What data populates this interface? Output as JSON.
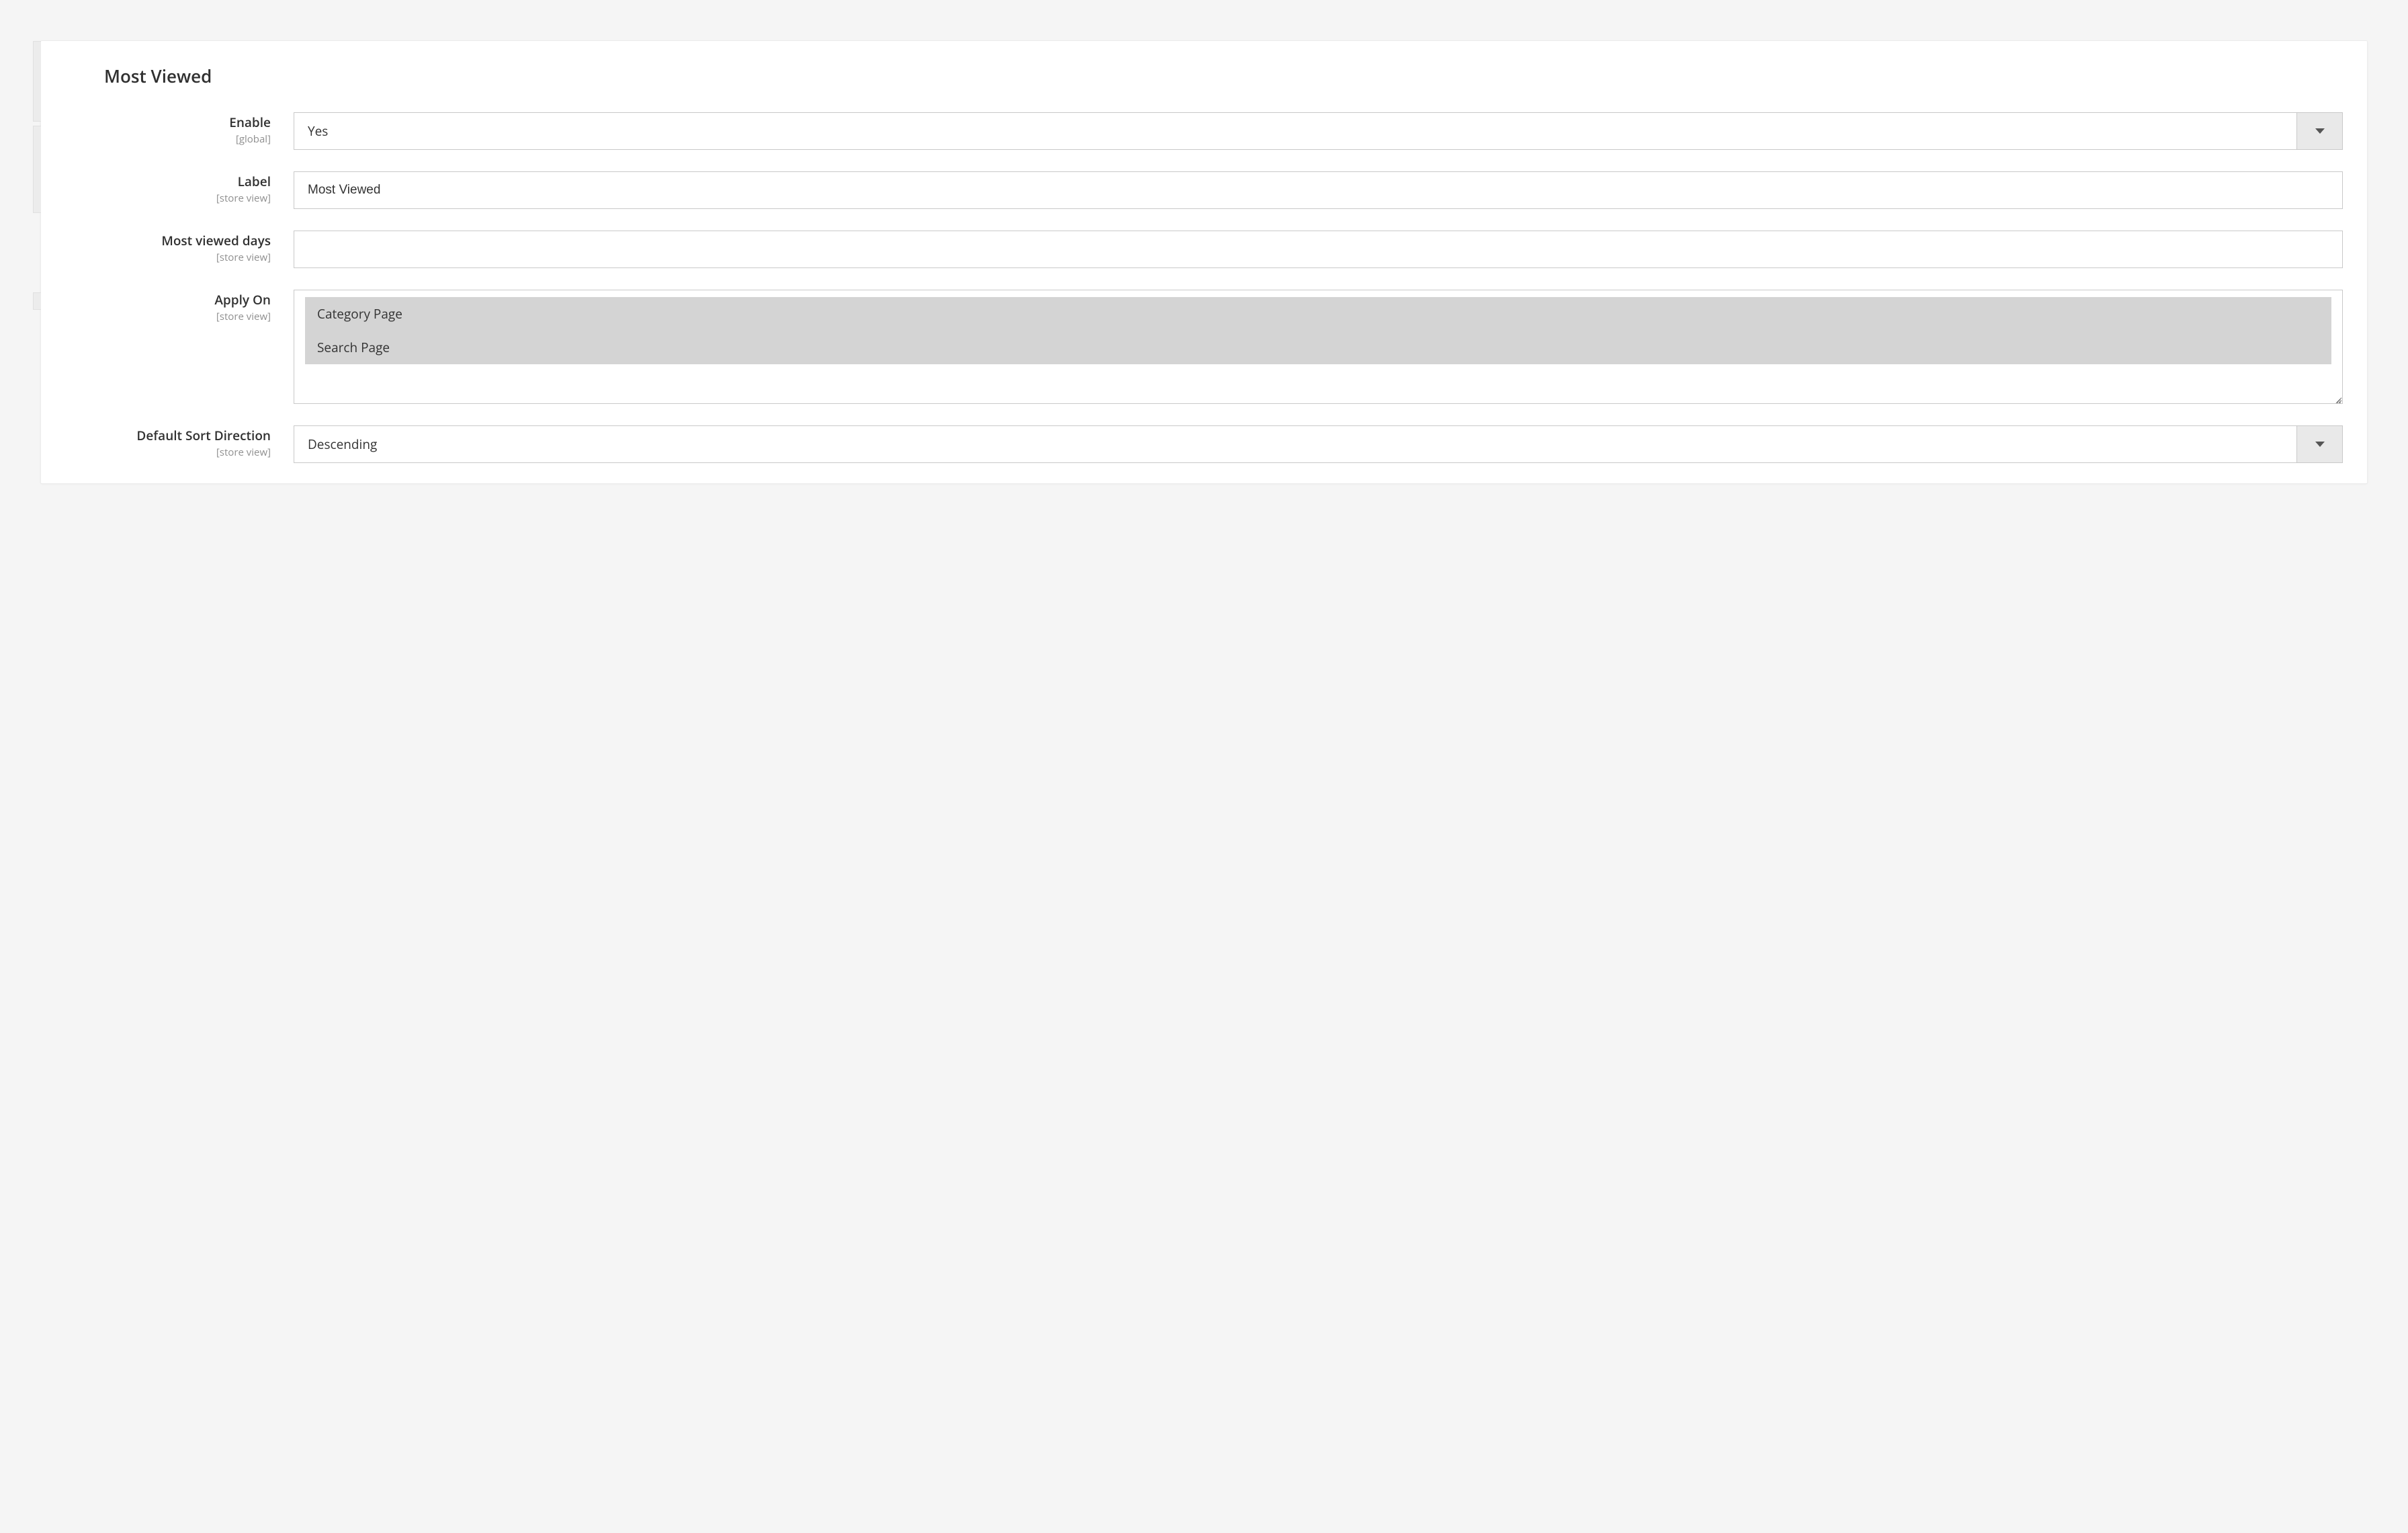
{
  "section": {
    "title": "Most Viewed"
  },
  "scopes": {
    "global": "[global]",
    "store_view": "[store view]"
  },
  "fields": {
    "enable": {
      "label": "Enable",
      "value": "Yes"
    },
    "label": {
      "label": "Label",
      "value": "Most Viewed"
    },
    "days": {
      "label": "Most viewed days",
      "value": ""
    },
    "apply_on": {
      "label": "Apply On",
      "options": [
        "Category Page",
        "Search Page"
      ],
      "selected": [
        "Category Page",
        "Search Page"
      ]
    },
    "sort_dir": {
      "label": "Default Sort Direction",
      "value": "Descending"
    }
  }
}
